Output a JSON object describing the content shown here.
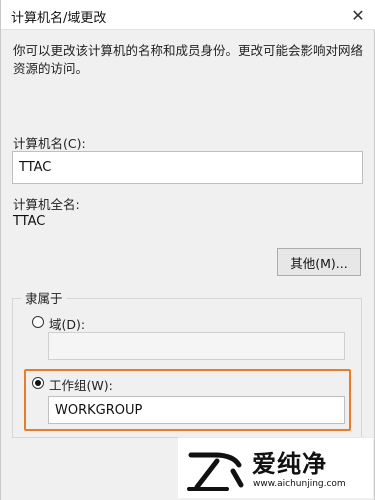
{
  "window": {
    "title": "计算机名/域更改",
    "close_glyph": "✕"
  },
  "content": {
    "description": "你可以更改该计算机的名称和成员身份。更改可能会影响对网络资源的访问。",
    "computer_name_label": "计算机名(C):",
    "computer_name_value": "TTAC",
    "full_name_label": "计算机全名:",
    "full_name_value": "TTAC",
    "more_button_label": "其他(M)...",
    "member_of_label": "隶属于",
    "domain_radio_label": "域(D):",
    "workgroup_radio_label": "工作组(W):",
    "workgroup_value": "WORKGROUP",
    "domain_value": ""
  },
  "watermark": {
    "text": "爱纯净",
    "url": "www.aichunjing.com"
  },
  "colors": {
    "highlight": "#e97c2b"
  }
}
